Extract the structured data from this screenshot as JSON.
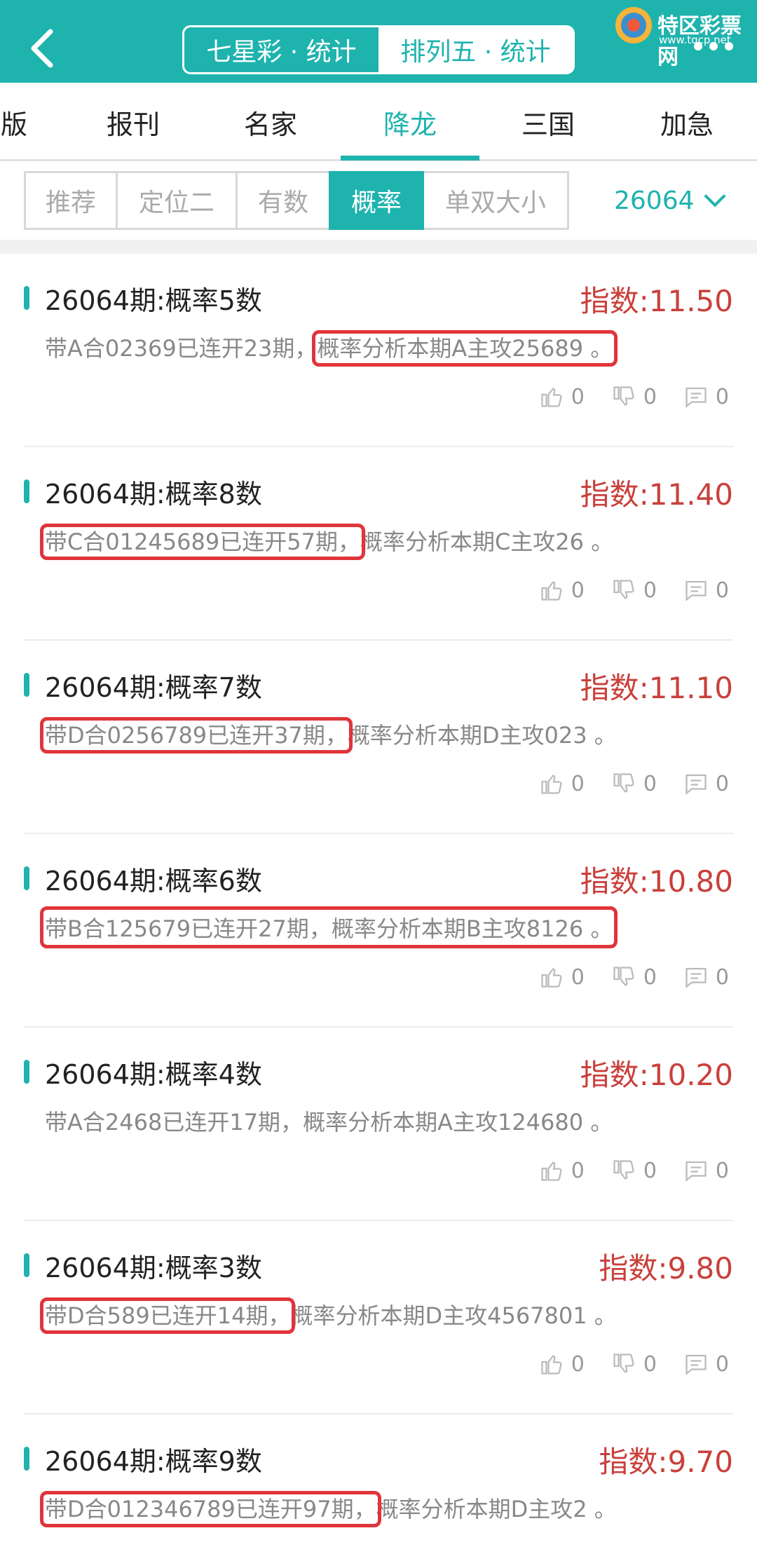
{
  "header": {
    "back_label": "‹",
    "seg_left": "七星彩 · 统计",
    "seg_right": "排列五 · 统计",
    "logo_name": "特区彩票网",
    "logo_url": "www.tqcp.net",
    "colors": {
      "primary": "#1fb3ae",
      "index_red": "#c9403b",
      "highlight": "#e0353b"
    }
  },
  "cat_tabs": [
    {
      "label": "版"
    },
    {
      "label": "报刊"
    },
    {
      "label": "名家"
    },
    {
      "label": "降龙"
    },
    {
      "label": "三国"
    },
    {
      "label": "加急"
    }
  ],
  "sub_tabs": [
    {
      "label": "推荐"
    },
    {
      "label": "定位二"
    },
    {
      "label": "有数"
    },
    {
      "label": "概率"
    },
    {
      "label": "单双大小"
    }
  ],
  "issue": "26064",
  "items": [
    {
      "title": "26064期:概率5数",
      "index": "指数:11.50",
      "desc_a": "带A合02369已连开23期，",
      "desc_b": "概率分析本期A主攻25689 。",
      "like": "0",
      "dislike": "0",
      "comment": "0"
    },
    {
      "title": "26064期:概率8数",
      "index": "指数:11.40",
      "desc_a": "带C合01245689已连开57期，",
      "desc_b": "概率分析本期C主攻26 。",
      "like": "0",
      "dislike": "0",
      "comment": "0"
    },
    {
      "title": "26064期:概率7数",
      "index": "指数:11.10",
      "desc_a": "带D合0256789已连开37期，",
      "desc_b": "概率分析本期D主攻023 。",
      "like": "0",
      "dislike": "0",
      "comment": "0"
    },
    {
      "title": "26064期:概率6数",
      "index": "指数:10.80",
      "desc_a": "带B合125679已连开27期，",
      "desc_b": "概率分析本期B主攻8126 。",
      "like": "0",
      "dislike": "0",
      "comment": "0"
    },
    {
      "title": "26064期:概率4数",
      "index": "指数:10.20",
      "desc_a": "带A合2468已连开17期，",
      "desc_b": "概率分析本期A主攻124680 。",
      "like": "0",
      "dislike": "0",
      "comment": "0"
    },
    {
      "title": "26064期:概率3数",
      "index": "指数:9.80",
      "desc_a": "带D合589已连开14期，",
      "desc_b": "概率分析本期D主攻4567801 。",
      "like": "0",
      "dislike": "0",
      "comment": "0"
    },
    {
      "title": "26064期:概率9数",
      "index": "指数:9.70",
      "desc_a": "带D合012346789已连开97期，",
      "desc_b": "概率分析本期D主攻2 。",
      "like": "0",
      "dislike": "0",
      "comment": "0"
    }
  ]
}
